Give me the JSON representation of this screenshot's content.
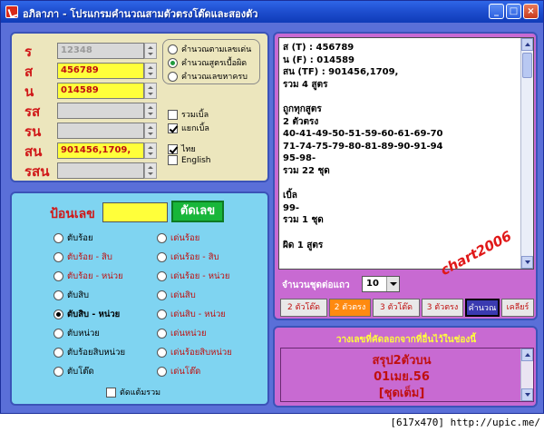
{
  "window": {
    "title": "อภิลาภา - โปรแกรมคำนวณสามตัวตรงโต๊ดและสองตัว",
    "controls": [
      "_",
      "□",
      "×"
    ]
  },
  "inputs": {
    "rows": [
      {
        "label": "ร",
        "value": "12348",
        "style": "grey"
      },
      {
        "label": "ส",
        "value": "456789",
        "style": "yellow"
      },
      {
        "label": "น",
        "value": "014589",
        "style": "yellow"
      },
      {
        "label": "รส",
        "value": "",
        "style": "grey"
      },
      {
        "label": "รน",
        "value": "",
        "style": "grey"
      },
      {
        "label": "สน",
        "value": "901456,1709,",
        "style": "yellow"
      },
      {
        "label": "รสน",
        "value": "",
        "style": "grey"
      }
    ],
    "modes": [
      {
        "label": "คำนวณตามเลขเด่น",
        "selected": false
      },
      {
        "label": "คำนวณสูตรเบื้อผิด",
        "selected": true
      },
      {
        "label": "คำนวณเลขหาครบ",
        "selected": false
      }
    ],
    "checks": [
      {
        "label": "รวมเบิ้ล",
        "checked": false
      },
      {
        "label": "แยกเบิ้ล",
        "checked": true
      },
      {
        "label": "ไทย",
        "checked": true
      },
      {
        "label": "English",
        "checked": false
      }
    ]
  },
  "entry": {
    "label": "ป้อนเลข",
    "value": "",
    "cut_button": "ตัดเลข"
  },
  "cut_options": {
    "left": [
      {
        "label": "ตับร้อย",
        "selected": false
      },
      {
        "label": "ตับร้อย - สิบ",
        "selected": false
      },
      {
        "label": "ตับร้อย - หน่วย",
        "selected": false
      },
      {
        "label": "ตับสิบ",
        "selected": false
      },
      {
        "label": "ตับสิบ - หน่วย",
        "selected": true
      },
      {
        "label": "ตับหน่วย",
        "selected": false
      },
      {
        "label": "ตับร้อยสิบหน่วย",
        "selected": false
      },
      {
        "label": "ตับโต๊ด",
        "selected": false
      }
    ],
    "right": [
      {
        "label": "เด่นร้อย",
        "selected": false
      },
      {
        "label": "เด่นร้อย - สิบ",
        "selected": false
      },
      {
        "label": "เด่นร้อย - หน่วย",
        "selected": false
      },
      {
        "label": "เด่นสิบ",
        "selected": false
      },
      {
        "label": "เด่นสิบ - หน่วย",
        "selected": false
      },
      {
        "label": "เด่นหน่วย",
        "selected": false
      },
      {
        "label": "เด่นร้อยสิบหน่วย",
        "selected": false
      },
      {
        "label": "เด่นโต๊ด",
        "selected": false
      }
    ],
    "all_check": {
      "label": "ตัดแต้มรวม",
      "checked": false
    }
  },
  "results": {
    "text": "ส (T) : 456789\nน (F) : 014589\nสน (TF) : 901456,1709,\nรวม 4 สูตร\n\nถูกทุกสูตร\n2 ตัวตรง\n40-41-49-50-51-59-60-61-69-70\n71-74-75-79-80-81-89-90-91-94\n95-98-\nรวม 22 ชุด\n\nเบิ้ล\n99-\nรวม 1 ชุด\n\nผิด 1 สูตร",
    "watermark": "chart2006",
    "count_label": "จำนวนชุดต่อแถว",
    "count_value": "10",
    "tabs": [
      {
        "label": "2 ตัวโต๊ด",
        "state": "normal"
      },
      {
        "label": "2 ตัวตรง",
        "state": "active"
      },
      {
        "label": "3 ตัวโต๊ด",
        "state": "normal"
      },
      {
        "label": "3 ตัวตรง",
        "state": "normal"
      },
      {
        "label": "คำนวณ",
        "state": "calc"
      },
      {
        "label": "เคลียร์",
        "state": "normal"
      }
    ]
  },
  "bottom": {
    "title": "วางเลขที่คัดลอกจากที่อื่นไว้ในช่องนี้",
    "lines": [
      "สรุป2ตัวบน",
      "01เมย.56",
      "[ชุดเต็ม]"
    ]
  },
  "footer": "[617x470] http://upic.me/",
  "colors": {
    "title_bar": "#1f4fd0",
    "input_panel": "#ece6bd",
    "button_panel": "#7fd4f1",
    "result_panel": "#c86ad2",
    "accent_red": "#d01818",
    "field_yellow": "#ffff3a",
    "cut_green": "#18b63a"
  }
}
